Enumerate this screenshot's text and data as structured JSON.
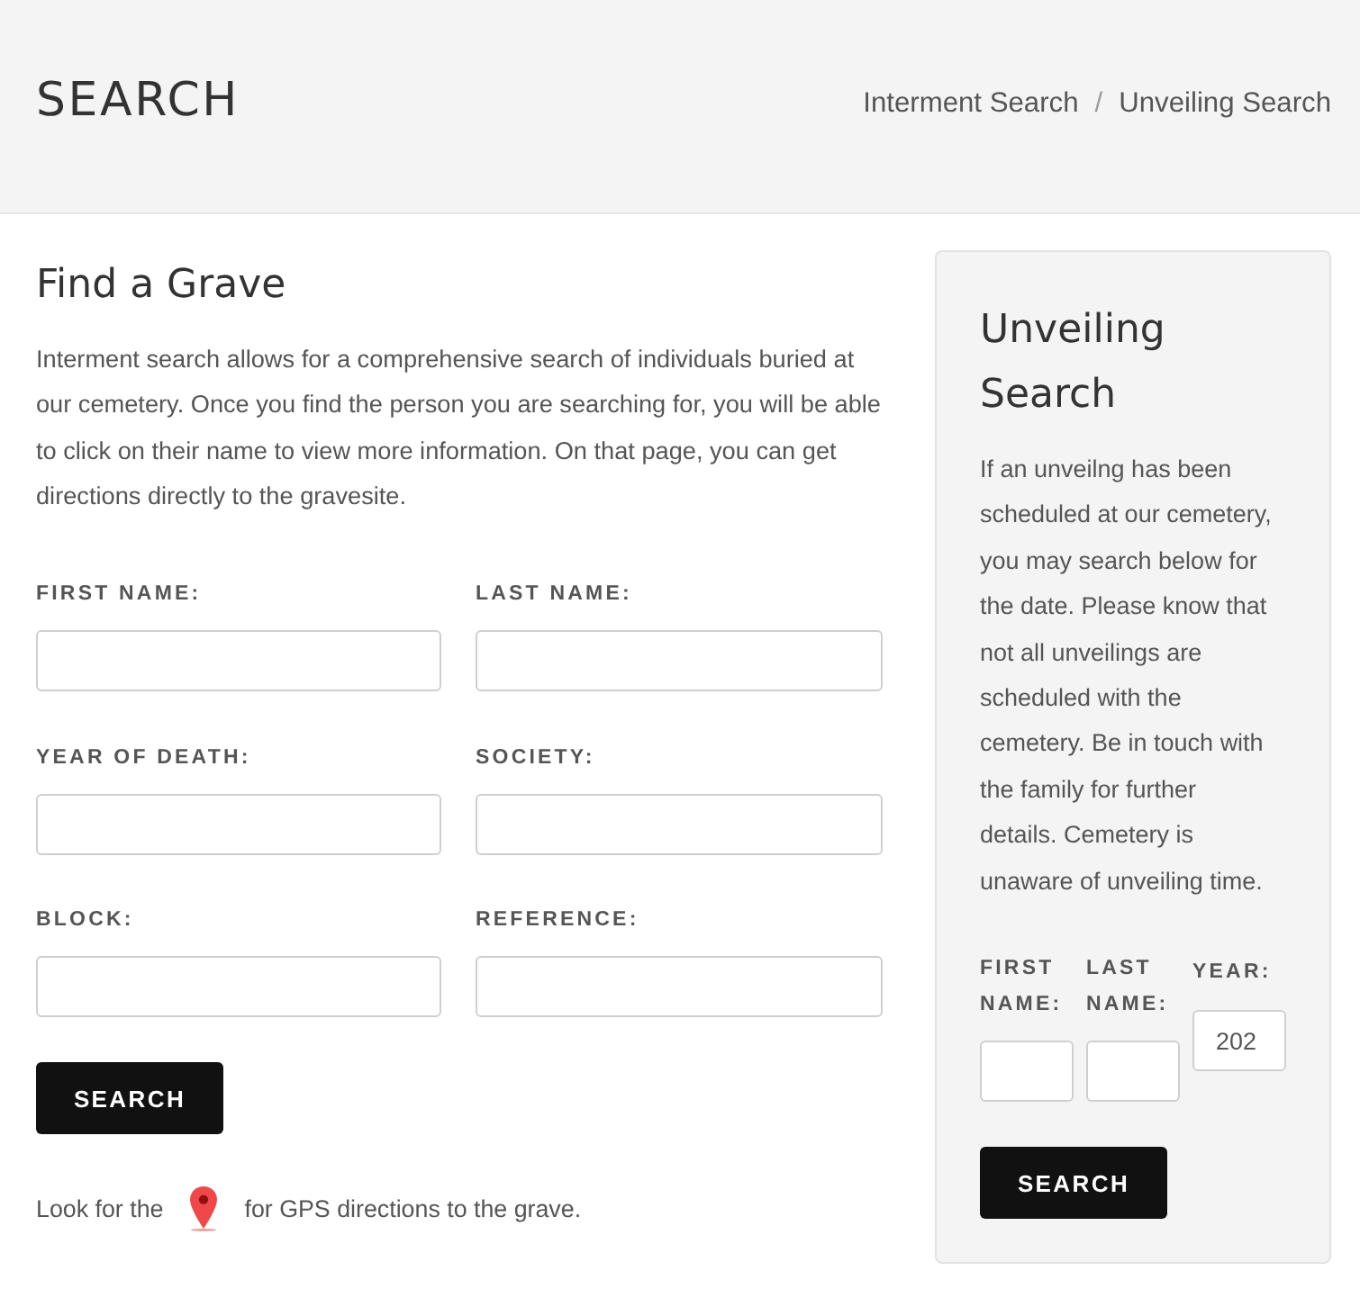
{
  "header": {
    "title": "SEARCH",
    "breadcrumbs": [
      {
        "label": "Interment Search"
      },
      {
        "label": "Unveiling Search"
      }
    ],
    "separator": "/"
  },
  "find_a_grave": {
    "heading": "Find a Grave",
    "intro": "Interment search allows for a comprehensive search of individuals buried at our cemetery. Once you find the person you are searching for, you will be able to click on their name to view more information. On that page, you can get directions directly to the gravesite.",
    "fields": [
      {
        "label": "FIRST NAME:"
      },
      {
        "label": "LAST NAME:"
      },
      {
        "label": "YEAR OF DEATH:"
      },
      {
        "label": "SOCIETY:"
      },
      {
        "label": "BLOCK:"
      },
      {
        "label": "REFERENCE:"
      }
    ],
    "button": "SEARCH",
    "gps_note": {
      "before": "Look for the",
      "after": "for GPS directions to the grave."
    }
  },
  "unveiling_search": {
    "heading": "Unveiling Search",
    "text": "If an unveilng has been scheduled at our cemetery, you may search below for the date. Please know that not all unveilings are scheduled with the cemetery. Be in touch with the family for further details. Cemetery is unaware of unveiling time.",
    "fields": [
      {
        "label": "FIRST NAME:"
      },
      {
        "label": "LAST NAME:"
      },
      {
        "label": "YEAR:",
        "value": "202"
      }
    ],
    "button": "SEARCH"
  }
}
